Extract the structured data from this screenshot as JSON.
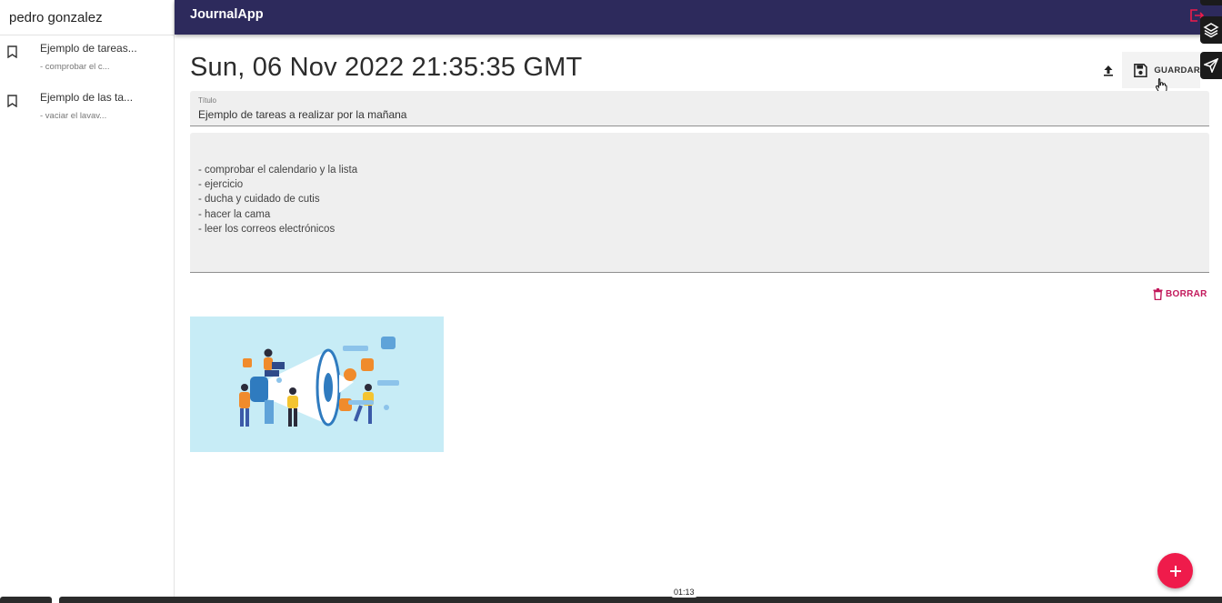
{
  "sidebar": {
    "user_name": "pedro gonzalez",
    "entries": [
      {
        "title": "Ejemplo de tareas...",
        "preview": "- comprobar el c..."
      },
      {
        "title": "Ejemplo de las ta...",
        "preview": "- vaciar el lavav..."
      }
    ]
  },
  "header": {
    "app_title": "JournalApp"
  },
  "note": {
    "date": "Sun, 06 Nov 2022 21:35:35 GMT",
    "save_label": "GUARDAR",
    "title_label": "Título",
    "title_value": "Ejemplo de tareas a realizar por la mañana",
    "body_lines": [
      "- comprobar el calendario y la lista",
      "- ejercicio",
      "- ducha y cuidado de cutis",
      "- hacer la cama",
      "- leer los correos electrónicos"
    ],
    "delete_label": "BORRAR"
  },
  "video": {
    "timestamp": "01:13"
  },
  "colors": {
    "appbar": "#2d2a5c",
    "accent": "#ef1b4b",
    "delete": "#c2185b"
  },
  "icons": [
    "bookmark-icon",
    "logout-icon",
    "layers-icon",
    "send-icon",
    "upload-icon",
    "save-icon",
    "trash-icon",
    "plus-icon",
    "pointer-cursor-icon"
  ]
}
